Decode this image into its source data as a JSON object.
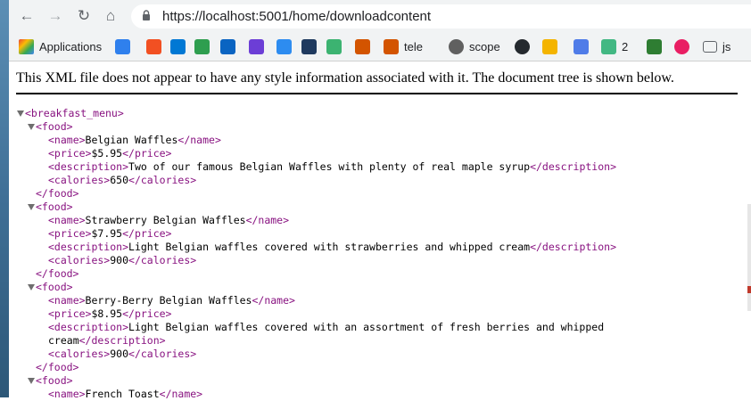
{
  "browser": {
    "url": "https://localhost:5001/home/downloadcontent",
    "bookmarks": [
      {
        "label": "Applications",
        "icon": "apps-grid-icon",
        "color": "#ea4335"
      },
      {
        "label": "",
        "icon": "cloud-icon",
        "color": "#2f80ed"
      },
      {
        "label": "",
        "icon": "microsoft-icon",
        "color": "#f25022"
      },
      {
        "label": "",
        "icon": "vscode-icon",
        "color": "#0078d4"
      },
      {
        "label": "",
        "icon": "cube-icon",
        "color": "#2e9e4f"
      },
      {
        "label": "",
        "icon": "outlook-icon",
        "color": "#0a64c2"
      },
      {
        "label": "",
        "icon": "lightning-icon",
        "color": "#6c3ed6"
      },
      {
        "label": "",
        "icon": "z-icon",
        "color": "#2d8cf0"
      },
      {
        "label": "",
        "icon": "diamond-icon",
        "color": "#1f3a5f"
      },
      {
        "label": "",
        "icon": "tree-icon",
        "color": "#3cb371"
      },
      {
        "label": "",
        "icon": "crest-icon",
        "color": "#d35400"
      },
      {
        "label": "tele",
        "icon": "crest-icon",
        "color": "#d35400"
      },
      {
        "label": "scope",
        "icon": "globe-icon",
        "color": "#606060"
      },
      {
        "label": "",
        "icon": "github-icon",
        "color": "#24292e"
      },
      {
        "label": "",
        "icon": "windows-icon",
        "color": "#f4b400"
      },
      {
        "label": "",
        "icon": "vue-icon",
        "color": "#4f7ce8"
      },
      {
        "label": "2",
        "icon": "vue-icon",
        "color": "#42b883"
      },
      {
        "label": "",
        "icon": "chart-icon",
        "color": "#2e7d32"
      },
      {
        "label": "",
        "icon": "play-icon",
        "color": "#e91e63"
      },
      {
        "label": "js",
        "icon": "folder-icon",
        "color": "#5f6368"
      }
    ]
  },
  "notice": "This XML file does not appear to have any style information associated with it. The document tree is shown below.",
  "xml_lines": [
    {
      "indent": 0,
      "toggle": true,
      "open": "<breakfast_menu>",
      "text": "",
      "close": ""
    },
    {
      "indent": 1,
      "toggle": true,
      "open": "<food>",
      "text": "",
      "close": ""
    },
    {
      "indent": 2,
      "toggle": false,
      "open": "<name>",
      "text": "Belgian Waffles",
      "close": "</name>"
    },
    {
      "indent": 2,
      "toggle": false,
      "open": "<price>",
      "text": "$5.95",
      "close": "</price>"
    },
    {
      "indent": 2,
      "toggle": false,
      "open": "<description>",
      "text": "Two of our famous Belgian Waffles with plenty of real maple syrup",
      "close": "</description>"
    },
    {
      "indent": 2,
      "toggle": false,
      "open": "<calories>",
      "text": "650",
      "close": "</calories>"
    },
    {
      "indent": 1,
      "toggle": false,
      "open": "</food>",
      "text": "",
      "close": ""
    },
    {
      "indent": 1,
      "toggle": true,
      "open": "<food>",
      "text": "",
      "close": ""
    },
    {
      "indent": 2,
      "toggle": false,
      "open": "<name>",
      "text": "Strawberry Belgian Waffles",
      "close": "</name>"
    },
    {
      "indent": 2,
      "toggle": false,
      "open": "<price>",
      "text": "$7.95",
      "close": "</price>"
    },
    {
      "indent": 2,
      "toggle": false,
      "open": "<description>",
      "text": "Light Belgian waffles covered with strawberries and whipped cream",
      "close": "</description>"
    },
    {
      "indent": 2,
      "toggle": false,
      "open": "<calories>",
      "text": "900",
      "close": "</calories>"
    },
    {
      "indent": 1,
      "toggle": false,
      "open": "</food>",
      "text": "",
      "close": ""
    },
    {
      "indent": 1,
      "toggle": true,
      "open": "<food>",
      "text": "",
      "close": ""
    },
    {
      "indent": 2,
      "toggle": false,
      "open": "<name>",
      "text": "Berry-Berry Belgian Waffles",
      "close": "</name>"
    },
    {
      "indent": 2,
      "toggle": false,
      "open": "<price>",
      "text": "$8.95",
      "close": "</price>"
    },
    {
      "indent": 2,
      "toggle": false,
      "open": "<description>",
      "text": "Light Belgian waffles covered with an assortment of fresh berries and whipped",
      "close": ""
    },
    {
      "indent": 2,
      "toggle": false,
      "open": "",
      "text": "cream",
      "close": "</description>"
    },
    {
      "indent": 2,
      "toggle": false,
      "open": "<calories>",
      "text": "900",
      "close": "</calories>"
    },
    {
      "indent": 1,
      "toggle": false,
      "open": "</food>",
      "text": "",
      "close": ""
    },
    {
      "indent": 1,
      "toggle": true,
      "open": "<food>",
      "text": "",
      "close": ""
    },
    {
      "indent": 2,
      "toggle": false,
      "open": "<name>",
      "text": "French Toast",
      "close": "</name>"
    }
  ]
}
